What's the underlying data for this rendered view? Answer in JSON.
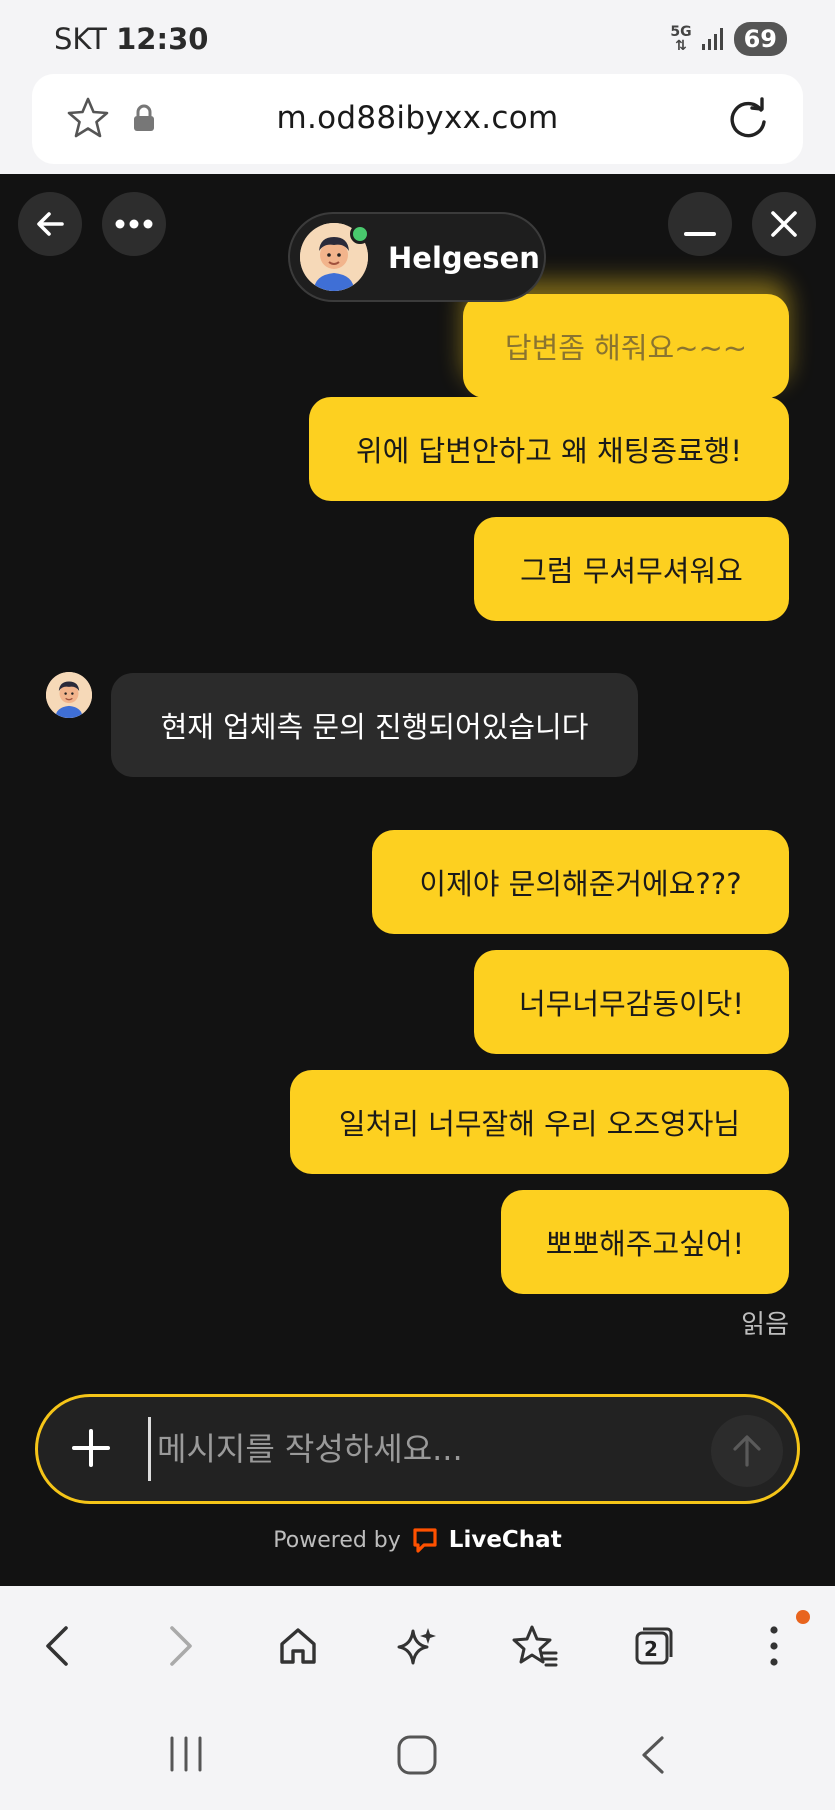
{
  "status_bar": {
    "carrier": "SKT",
    "time": "12:30",
    "network": "5G",
    "battery": "69"
  },
  "browser": {
    "url": "m.od88ibyxx.com"
  },
  "chat": {
    "agent_name": "Helgesen",
    "messages": [
      {
        "from": "user",
        "text": "답변좀 해줘요~~~"
      },
      {
        "from": "user",
        "text": "위에 답변안하고 왜 채팅종료행!"
      },
      {
        "from": "user",
        "text": "그럼 무셔무셔워요"
      },
      {
        "from": "agent",
        "text": "현재 업체측 문의 진행되어있습니다"
      },
      {
        "from": "user",
        "text": "이제야 문의해준거에요???"
      },
      {
        "from": "user",
        "text": "너무너무감동이닷!"
      },
      {
        "from": "user",
        "text": "일처리 너무잘해 우리 오즈영자님"
      },
      {
        "from": "user",
        "text": "뽀뽀해주고싶어!"
      }
    ],
    "read_label": "읽음",
    "composer_placeholder": "메시지를 작성하세요...",
    "powered_by": "Powered by",
    "brand": "LiveChat",
    "accent_color": "#fdd020"
  },
  "toolbar": {
    "tab_count": "2"
  },
  "icons": [
    "back-arrow-icon",
    "more-icon",
    "minimize-icon",
    "close-icon",
    "star-icon",
    "lock-icon",
    "reload-icon",
    "plus-icon",
    "send-arrow-icon",
    "livechat-logo-icon",
    "back-icon",
    "forward-icon",
    "home-icon",
    "sparkle-icon",
    "bookmarks-icon",
    "tabs-icon",
    "menu-dots-icon",
    "recents-icon",
    "home-circle-icon",
    "nav-back-icon"
  ]
}
